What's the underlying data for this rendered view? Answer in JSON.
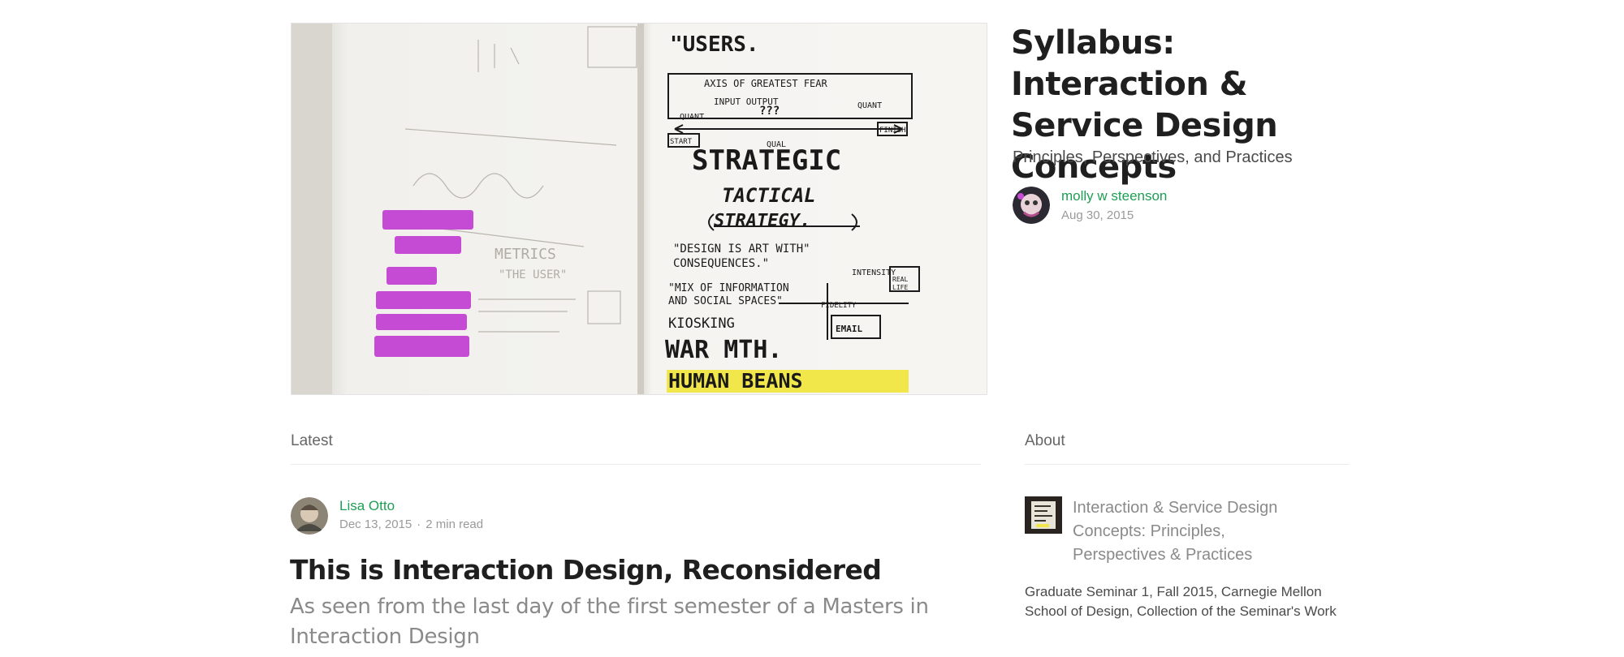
{
  "publication": {
    "title": "Syllabus: Interaction & Service Design Concepts",
    "subtitle": "Principles, Perspectives, and Practices",
    "author": "molly w steenson",
    "date": "Aug 30, 2015"
  },
  "hero_sketch": {
    "lines": [
      "USERS.",
      "AXIS OF GREATEST FEAR",
      "INPUT  OUTPUT",
      "QUANT  ???  QUANT",
      "START  QUAL  FINISH",
      "STRATEGIC",
      "TACTICAL",
      "STRATEGY",
      "\"DESIGN IS ART WITH CONSEQUENCES\"",
      "MIX OF INFORMATION AND SOCIAL SPACES",
      "FIDELITY",
      "INTENSITY",
      "REAL LIFE",
      "WAR MTH",
      "HUMAN BEANS",
      "EMAIL",
      "METRICS",
      "\"THE USER\""
    ]
  },
  "sections": {
    "latest": "Latest",
    "about": "About"
  },
  "latest_post": {
    "author": "Lisa Otto",
    "date": "Dec 13, 2015",
    "read_time": "2 min read",
    "separator": "·",
    "title": "This is Interaction Design, Reconsidered",
    "subtitle": "As seen from the last day of the first semester of a Masters in Interaction Design"
  },
  "about": {
    "name": "Interaction & Service Design Concepts: Principles, Perspectives & Practices",
    "description": "Graduate Seminar 1, Fall 2015, Carnegie Mellon School of Design, Collection of the Seminar's Work"
  },
  "colors": {
    "accent_green": "#1d9e55",
    "highlight_magenta": "#c64bd4",
    "highlight_yellow": "#f1e64a"
  }
}
